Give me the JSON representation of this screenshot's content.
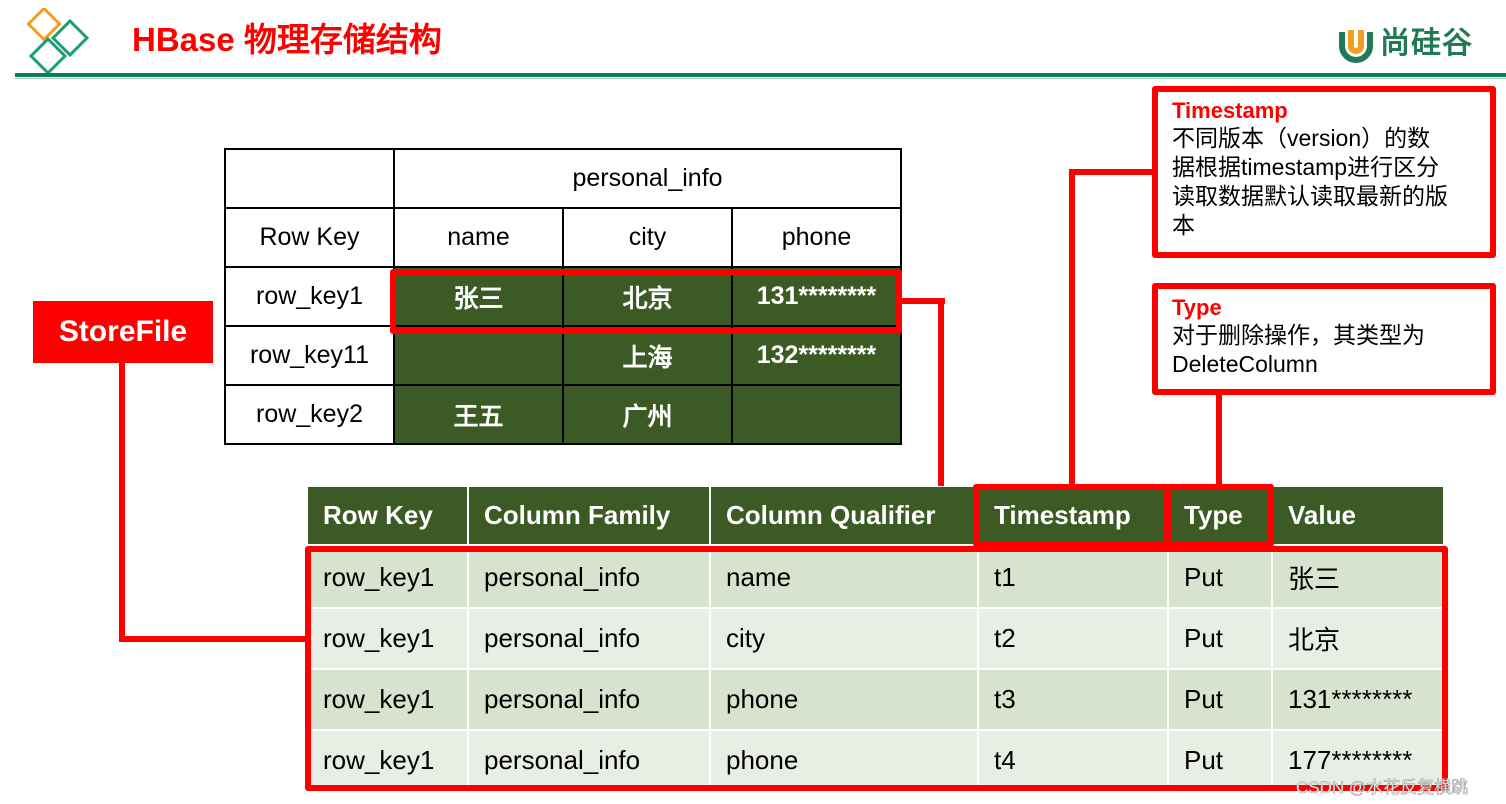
{
  "header": {
    "title": "HBase 物理存储结构",
    "brand": "尚硅谷",
    "colors": {
      "title": "#ff0000",
      "rule": "#127a5a",
      "brand": "#1f7a55",
      "accent_orange": "#f0a020"
    }
  },
  "storefile_label": "StoreFile",
  "logical_table": {
    "column_family": "personal_info",
    "headers": [
      "Row Key",
      "name",
      "city",
      "phone"
    ],
    "rows": [
      {
        "row_key": "row_key1",
        "name": "张三",
        "city": "北京",
        "phone": "131********"
      },
      {
        "row_key": "row_key11",
        "name": "",
        "city": "上海",
        "phone": "132********"
      },
      {
        "row_key": "row_key2",
        "name": "王五",
        "city": "广州",
        "phone": ""
      }
    ],
    "highlighted_row": "row_key1",
    "cell_color": "#3b5a24"
  },
  "callouts": {
    "timestamp": {
      "title": "Timestamp",
      "lines": [
        "不同版本（version）的数",
        "据根据timestamp进行区分",
        "读取数据默认读取最新的版",
        "本"
      ]
    },
    "type": {
      "title": "Type",
      "lines": [
        "对于删除操作，其类型为",
        "DeleteColumn"
      ]
    }
  },
  "physical_table": {
    "headers": [
      "Row Key",
      "Column Family",
      "Column Qualifier",
      "Timestamp",
      "Type",
      "Value"
    ],
    "highlighted_headers": [
      "Timestamp",
      "Type"
    ],
    "rows": [
      [
        "row_key1",
        "personal_info",
        "name",
        "t1",
        "Put",
        "张三"
      ],
      [
        "row_key1",
        "personal_info",
        "city",
        "t2",
        "Put",
        "北京"
      ],
      [
        "row_key1",
        "personal_info",
        "phone",
        "t3",
        "Put",
        "131********"
      ],
      [
        "row_key1",
        "personal_info",
        "phone",
        "t4",
        "Put",
        "177********"
      ]
    ],
    "colors": {
      "header": "#3b5a24",
      "row_odd": "#d7e3cf",
      "row_even": "#e9eee5",
      "highlight": "#ff0000"
    }
  },
  "watermark": "CSDN @水花反复横跳"
}
